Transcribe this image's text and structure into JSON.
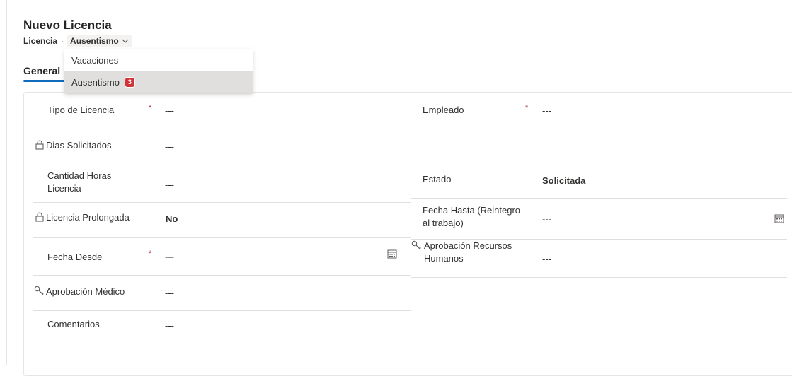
{
  "header": {
    "title": "Nuevo Licencia",
    "entity": "Licencia",
    "separator": "·",
    "form_name": "Ausentismo"
  },
  "tabs": [
    {
      "label": "General",
      "selected": true
    }
  ],
  "form_dropdown": {
    "options": [
      {
        "label": "Vacaciones"
      },
      {
        "label": "Ausentismo",
        "badge": "3",
        "highlighted": true
      }
    ]
  },
  "left_column": [
    {
      "label": "Tipo de Licencia",
      "required_mark": "*",
      "value": "---"
    },
    {
      "label": "Dias Solicitados",
      "icon": "lock-icon",
      "value": "---"
    },
    {
      "label": "Cantidad Horas Licencia",
      "value": "---"
    },
    {
      "label": "Licencia Prolongada",
      "icon": "lock-icon",
      "value": "No"
    },
    {
      "label": "Fecha Desde",
      "required_mark": "*",
      "value": "---",
      "icon_right": "calendar-icon"
    },
    {
      "label": "Aprobación Médico",
      "icon": "key-icon",
      "value": "---"
    },
    {
      "label": "Comentarios",
      "value": "---"
    }
  ],
  "right_column": [
    {
      "label": "Empleado",
      "required_mark": "*",
      "value": "---"
    },
    {
      "label": "Estado",
      "value": "Solicitada"
    },
    {
      "label": "Fecha Hasta (Reintegro al trabajo)",
      "value": "---",
      "icon_right": "calendar-icon"
    },
    {
      "label": "Aprobación Recursos Humanos",
      "icon": "key-icon",
      "value": "---"
    }
  ],
  "colors": {
    "accent": "#0f6cbd",
    "required": "#a4262c",
    "badge": "#d13438",
    "highlight": "#e1dfdd"
  }
}
